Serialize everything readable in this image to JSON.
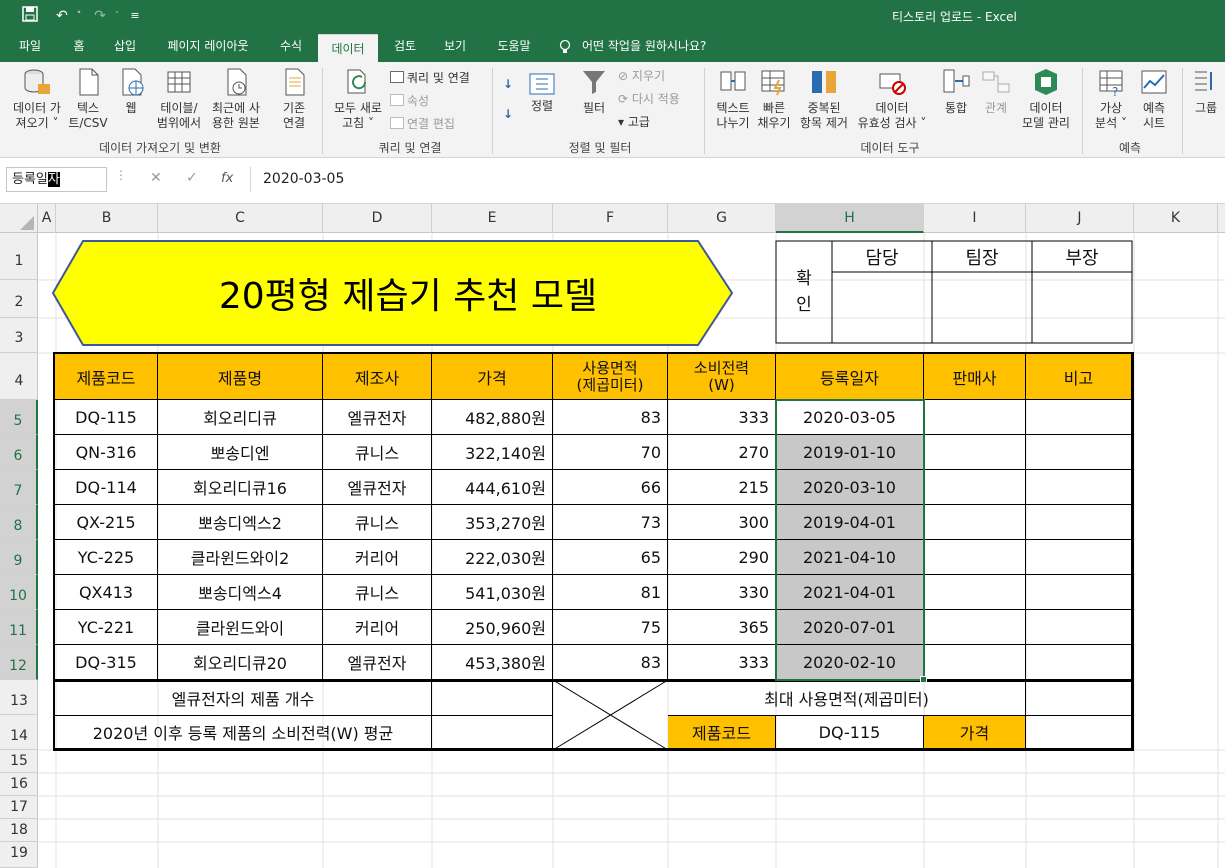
{
  "app": {
    "title": "티스토리 업로드  -  Excel"
  },
  "qat": {
    "save_icon": "save-icon",
    "undo_icon": "undo-icon",
    "redo_icon": "redo-icon",
    "customize_icon": "customize-qat-icon"
  },
  "tabs": [
    "파일",
    "홈",
    "삽입",
    "페이지 레이아웃",
    "수식",
    "데이터",
    "검토",
    "보기",
    "도움말"
  ],
  "tellme": "어떤 작업을 원하시나요?",
  "ribbon": {
    "get_data": "데이터 가\n져오기 ˅",
    "text_csv": "텍스\n트/CSV",
    "web": "웹",
    "table_range": "테이블/\n범위에서",
    "recent_sources": "최근에 사\n용한 원본",
    "existing": "기존\n연결",
    "group1": "데이터 가져오기 및 변환",
    "refresh_all": "모두 새로\n고침 ˅",
    "queries_conn": "쿼리 및 연결",
    "properties": "속성",
    "edit_links": "연결 편집",
    "group2": "쿼리 및 연결",
    "sort": "정렬",
    "filter": "필터",
    "clear": "지우기",
    "reapply": "다시 적용",
    "advanced": "고급",
    "group3": "정렬 및 필터",
    "text_to_columns": "텍스트\n나누기",
    "flash_fill": "빠른\n채우기",
    "remove_dup": "중복된\n항목 제거",
    "validation": "데이터\n유효성 검사 ˅",
    "consolidate": "통합",
    "relationships": "관계",
    "data_model": "데이터\n모델 관리",
    "group4": "데이터 도구",
    "whatif": "가상\n분석 ˅",
    "forecast": "예측\n시트",
    "group5": "예측",
    "group_outline": "그룹"
  },
  "formula_bar": {
    "name_box_prefix": "등록일",
    "name_box_highlight": "자",
    "cancel": "✕",
    "enter": "✓",
    "fx": "fx",
    "content": "2020-03-05"
  },
  "columns": [
    "A",
    "B",
    "C",
    "D",
    "E",
    "F",
    "G",
    "H",
    "I",
    "J",
    "K"
  ],
  "rows": [
    "1",
    "2",
    "3",
    "4",
    "5",
    "6",
    "7",
    "8",
    "9",
    "10",
    "11",
    "12",
    "13",
    "14",
    "15",
    "16",
    "17",
    "18",
    "19"
  ],
  "sheet": {
    "title": "20평형 제습기 추천 모델",
    "approval": {
      "label": "확\n인",
      "roles": [
        "담당",
        "팀장",
        "부장"
      ]
    },
    "headers": [
      "제품코드",
      "제품명",
      "제조사",
      "가격",
      "사용면적\n(제곱미터)",
      "소비전력\n(W)",
      "등록일자",
      "판매사",
      "비고"
    ],
    "data": [
      [
        "DQ-115",
        "회오리디큐",
        "엘큐전자",
        "482,880원",
        "83",
        "333",
        "2020-03-05",
        "",
        ""
      ],
      [
        "QN-316",
        "뽀송디엔",
        "큐니스",
        "322,140원",
        "70",
        "270",
        "2019-01-10",
        "",
        ""
      ],
      [
        "DQ-114",
        "회오리디큐16",
        "엘큐전자",
        "444,610원",
        "66",
        "215",
        "2020-03-10",
        "",
        ""
      ],
      [
        "QX-215",
        "뽀송디엑스2",
        "큐니스",
        "353,270원",
        "73",
        "300",
        "2019-04-01",
        "",
        ""
      ],
      [
        "YC-225",
        "클라윈드와이2",
        "커리어",
        "222,030원",
        "65",
        "290",
        "2021-04-10",
        "",
        ""
      ],
      [
        "QX413",
        "뽀송디엑스4",
        "큐니스",
        "541,030원",
        "81",
        "330",
        "2021-04-01",
        "",
        ""
      ],
      [
        "YC-221",
        "클라윈드와이",
        "커리어",
        "250,960원",
        "75",
        "365",
        "2020-07-01",
        "",
        ""
      ],
      [
        "DQ-315",
        "회오리디큐20",
        "엘큐전자",
        "453,380원",
        "83",
        "333",
        "2020-02-10",
        "",
        ""
      ]
    ],
    "summary": {
      "lq_count": "엘큐전자의 제품 개수",
      "avg_power": "2020년 이후 등록 제품의 소비전력(W) 평균",
      "max_area": "최대 사용면적(제곱미터)",
      "code_label": "제품코드",
      "code_value": "DQ-115",
      "price_label": "가격"
    }
  }
}
